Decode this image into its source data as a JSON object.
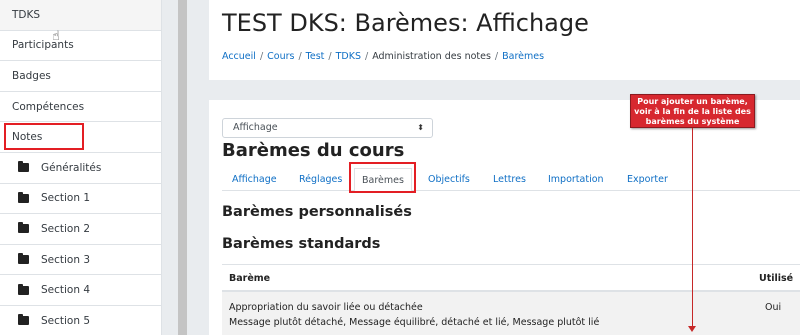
{
  "sidebar": {
    "items": [
      {
        "label": "TDKS",
        "folder": false
      },
      {
        "label": "Participants",
        "folder": false
      },
      {
        "label": "Badges",
        "folder": false
      },
      {
        "label": "Compétences",
        "folder": false
      },
      {
        "label": "Notes",
        "folder": false
      },
      {
        "label": "Généralités",
        "folder": true
      },
      {
        "label": "Section 1",
        "folder": true
      },
      {
        "label": "Section 2",
        "folder": true
      },
      {
        "label": "Section 3",
        "folder": true
      },
      {
        "label": "Section 4",
        "folder": true
      },
      {
        "label": "Section 5",
        "folder": true
      }
    ]
  },
  "header": {
    "title": "TEST DKS: Barèmes: Affichage",
    "breadcrumb": [
      "Accueil",
      "Cours",
      "Test",
      "TDKS",
      "Administration des notes",
      "Barèmes"
    ],
    "breadcrumb_sep": "/"
  },
  "main": {
    "select_value": "Affichage",
    "section_title": "Barèmes du cours",
    "tabs": [
      "Affichage",
      "Réglages",
      "Barèmes",
      "Objectifs",
      "Lettres",
      "Importation",
      "Exporter"
    ],
    "active_tab": "Barèmes",
    "custom_heading": "Barèmes personnalisés",
    "standard_heading": "Barèmes standards",
    "table": {
      "headers": [
        "Barème",
        "Utilisé"
      ],
      "rows": [
        {
          "name": "Appropriation du savoir liée ou détachée",
          "items": "Message plutôt détaché, Message équilibré, détaché et lié, Message plutôt lié",
          "used": "Oui"
        }
      ]
    }
  },
  "annotation": {
    "lines": [
      "Pour ajouter un barème,",
      "voir à la fin de la liste des",
      "barèmes du système"
    ]
  },
  "colors": {
    "link": "#0f6fc5",
    "highlight": "#e31e24",
    "callout": "#d7282f"
  }
}
